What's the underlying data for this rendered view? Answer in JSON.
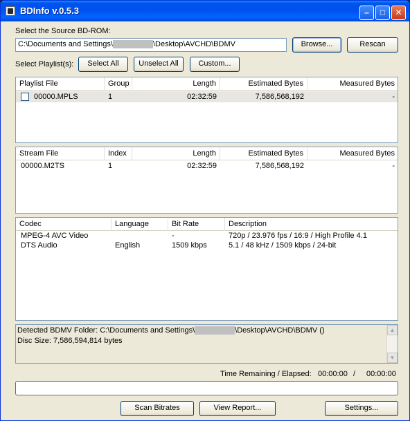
{
  "window": {
    "title": "BDInfo v.0.5.3"
  },
  "titlebar": {
    "min_glyph": "–",
    "max_glyph": "□",
    "close_glyph": "✕"
  },
  "source": {
    "label": "Select the Source BD-ROM:",
    "path_prefix": "C:\\Documents and Settings\\",
    "path_suffix": "\\Desktop\\AVCHD\\BDMV",
    "browse_label": "Browse...",
    "rescan_label": "Rescan"
  },
  "playlist_controls": {
    "label": "Select Playlist(s):",
    "select_all_label": "Select All",
    "unselect_all_label": "Unselect All",
    "custom_label": "Custom..."
  },
  "playlist_table": {
    "headers": [
      "Playlist File",
      "Group",
      "Length",
      "Estimated Bytes",
      "Measured Bytes"
    ],
    "rows": [
      {
        "file": "00000.MPLS",
        "group": "1",
        "length": "02:32:59",
        "estimated": "7,586,568,192",
        "measured": "-",
        "checked": false
      }
    ]
  },
  "stream_table": {
    "headers": [
      "Stream File",
      "Index",
      "Length",
      "Estimated Bytes",
      "Measured Bytes"
    ],
    "rows": [
      {
        "file": "00000.M2TS",
        "index": "1",
        "length": "02:32:59",
        "estimated": "7,586,568,192",
        "measured": "-"
      }
    ]
  },
  "codec_table": {
    "headers": [
      "Codec",
      "Language",
      "Bit Rate",
      "Description"
    ],
    "rows": [
      {
        "codec": "MPEG-4 AVC Video",
        "language": "",
        "bitrate": "-",
        "description": "720p / 23.976 fps / 16:9 / High Profile 4.1"
      },
      {
        "codec": "DTS Audio",
        "language": "English",
        "bitrate": "1509 kbps",
        "description": "5.1 / 48 kHz / 1509 kbps / 24-bit"
      }
    ]
  },
  "info": {
    "line1_prefix": "Detected BDMV Folder: C:\\Documents and Settings\\",
    "line1_suffix": "\\Desktop\\AVCHD\\BDMV ()",
    "line2": "Disc Size: 7,586,594,814 bytes"
  },
  "timing": {
    "label": "Time Remaining / Elapsed:",
    "remaining": "00:00:00",
    "separator": "/",
    "elapsed": "00:00:00"
  },
  "progress": {
    "value": 0
  },
  "bottom_buttons": {
    "scan_label": "Scan Bitrates",
    "report_label": "View Report...",
    "settings_label": "Settings..."
  }
}
